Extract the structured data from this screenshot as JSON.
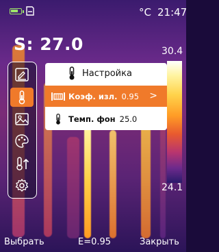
{
  "status": {
    "battery_level": 0.8,
    "unit": "°C",
    "time": "21:47"
  },
  "spot": {
    "label": "S: 27.0"
  },
  "scale": {
    "max": "30.4",
    "min": "24.1"
  },
  "sidebar": {
    "tools": [
      {
        "icon": "measure-edit-icon"
      },
      {
        "icon": "thermometer-icon",
        "active": true
      },
      {
        "icon": "image-icon"
      },
      {
        "icon": "palette-icon"
      },
      {
        "icon": "thermometer-up-icon"
      },
      {
        "icon": "gear-icon"
      }
    ]
  },
  "menu": {
    "title": "Настройка",
    "rows": [
      {
        "label": "Коэф. изл.",
        "value": "0.95",
        "icon": "emissivity-icon",
        "selected": true
      },
      {
        "label": "Темп. фон",
        "value": "25.0",
        "icon": "thermometer-icon"
      }
    ],
    "chevron": ">"
  },
  "bottom": {
    "select": "Выбрать",
    "emissivity": "E=0.95",
    "close": "Закрыть"
  },
  "colors": {
    "accent": "#f07a2a",
    "battery": "#9ee56a",
    "panel": "#ffffff"
  }
}
